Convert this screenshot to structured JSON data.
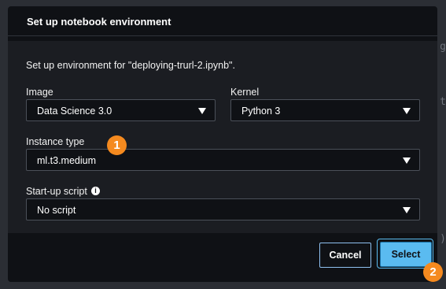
{
  "background": {
    "glyphs": [
      "g",
      "t",
      ")"
    ]
  },
  "dialog": {
    "title": "Set up notebook environment",
    "intro": "Set up environment for \"deploying-trurl-2.ipynb\".",
    "image": {
      "label": "Image",
      "value": "Data Science 3.0"
    },
    "kernel": {
      "label": "Kernel",
      "value": "Python 3"
    },
    "instance_type": {
      "label": "Instance type",
      "value": "ml.t3.medium"
    },
    "startup_script": {
      "label": "Start-up script",
      "value": "No script",
      "info_icon": "i"
    },
    "cancel_label": "Cancel",
    "select_label": "Select"
  },
  "annotations": {
    "badge_1": "1",
    "badge_2": "2"
  },
  "colors": {
    "accent": "#5abbf0",
    "badge": "#f58a1f",
    "dialog_bg": "#0f1115",
    "body_bg": "#1b1d22"
  }
}
